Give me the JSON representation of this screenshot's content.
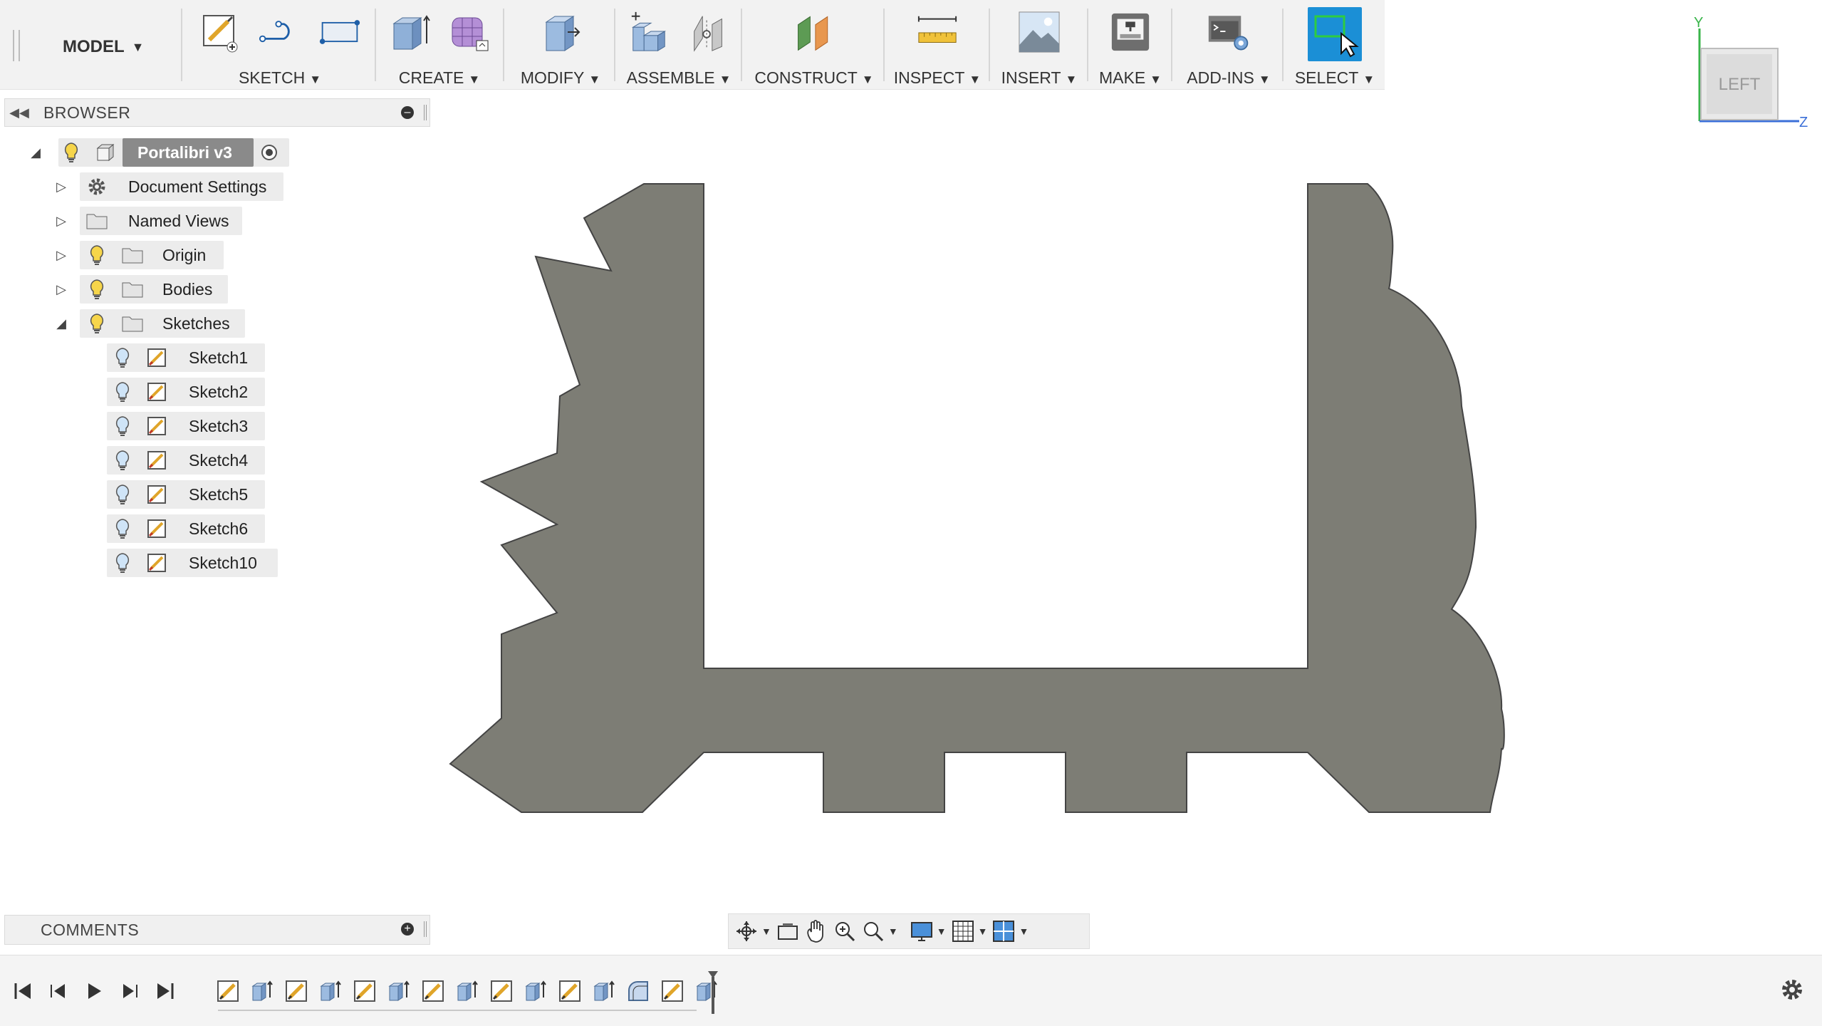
{
  "toolbar": {
    "workspace": "MODEL",
    "groups": [
      {
        "label": "SKETCH"
      },
      {
        "label": "CREATE"
      },
      {
        "label": "MODIFY"
      },
      {
        "label": "ASSEMBLE"
      },
      {
        "label": "CONSTRUCT"
      },
      {
        "label": "INSPECT"
      },
      {
        "label": "INSERT"
      },
      {
        "label": "MAKE"
      },
      {
        "label": "ADD-INS"
      },
      {
        "label": "SELECT"
      }
    ],
    "select_active_color": "#1b8fd6"
  },
  "browser": {
    "title": "BROWSER",
    "root": {
      "label": "Portalibri v3"
    },
    "items": [
      {
        "label": "Document Settings",
        "icon": "gear-icon"
      },
      {
        "label": "Named Views",
        "icon": "folder-icon"
      },
      {
        "label": "Origin",
        "icon": "folder-icon"
      },
      {
        "label": "Bodies",
        "icon": "folder-icon"
      },
      {
        "label": "Sketches",
        "icon": "folder-icon"
      }
    ],
    "sketches": [
      {
        "label": "Sketch1"
      },
      {
        "label": "Sketch2"
      },
      {
        "label": "Sketch3"
      },
      {
        "label": "Sketch4"
      },
      {
        "label": "Sketch5"
      },
      {
        "label": "Sketch6"
      },
      {
        "label": "Sketch10"
      }
    ]
  },
  "comments": {
    "title": "COMMENTS"
  },
  "viewcube": {
    "face": "LEFT",
    "axis_y": "Y",
    "axis_z": "Z"
  },
  "model": {
    "fill_color": "#7d7d75",
    "edge_color": "#444444"
  },
  "timeline": {
    "features": [
      "sketch",
      "extrude",
      "sketch",
      "extrude",
      "sketch",
      "extrude",
      "sketch",
      "extrude",
      "sketch",
      "extrude",
      "sketch",
      "extrude",
      "fillet",
      "sketch",
      "extrude"
    ]
  }
}
